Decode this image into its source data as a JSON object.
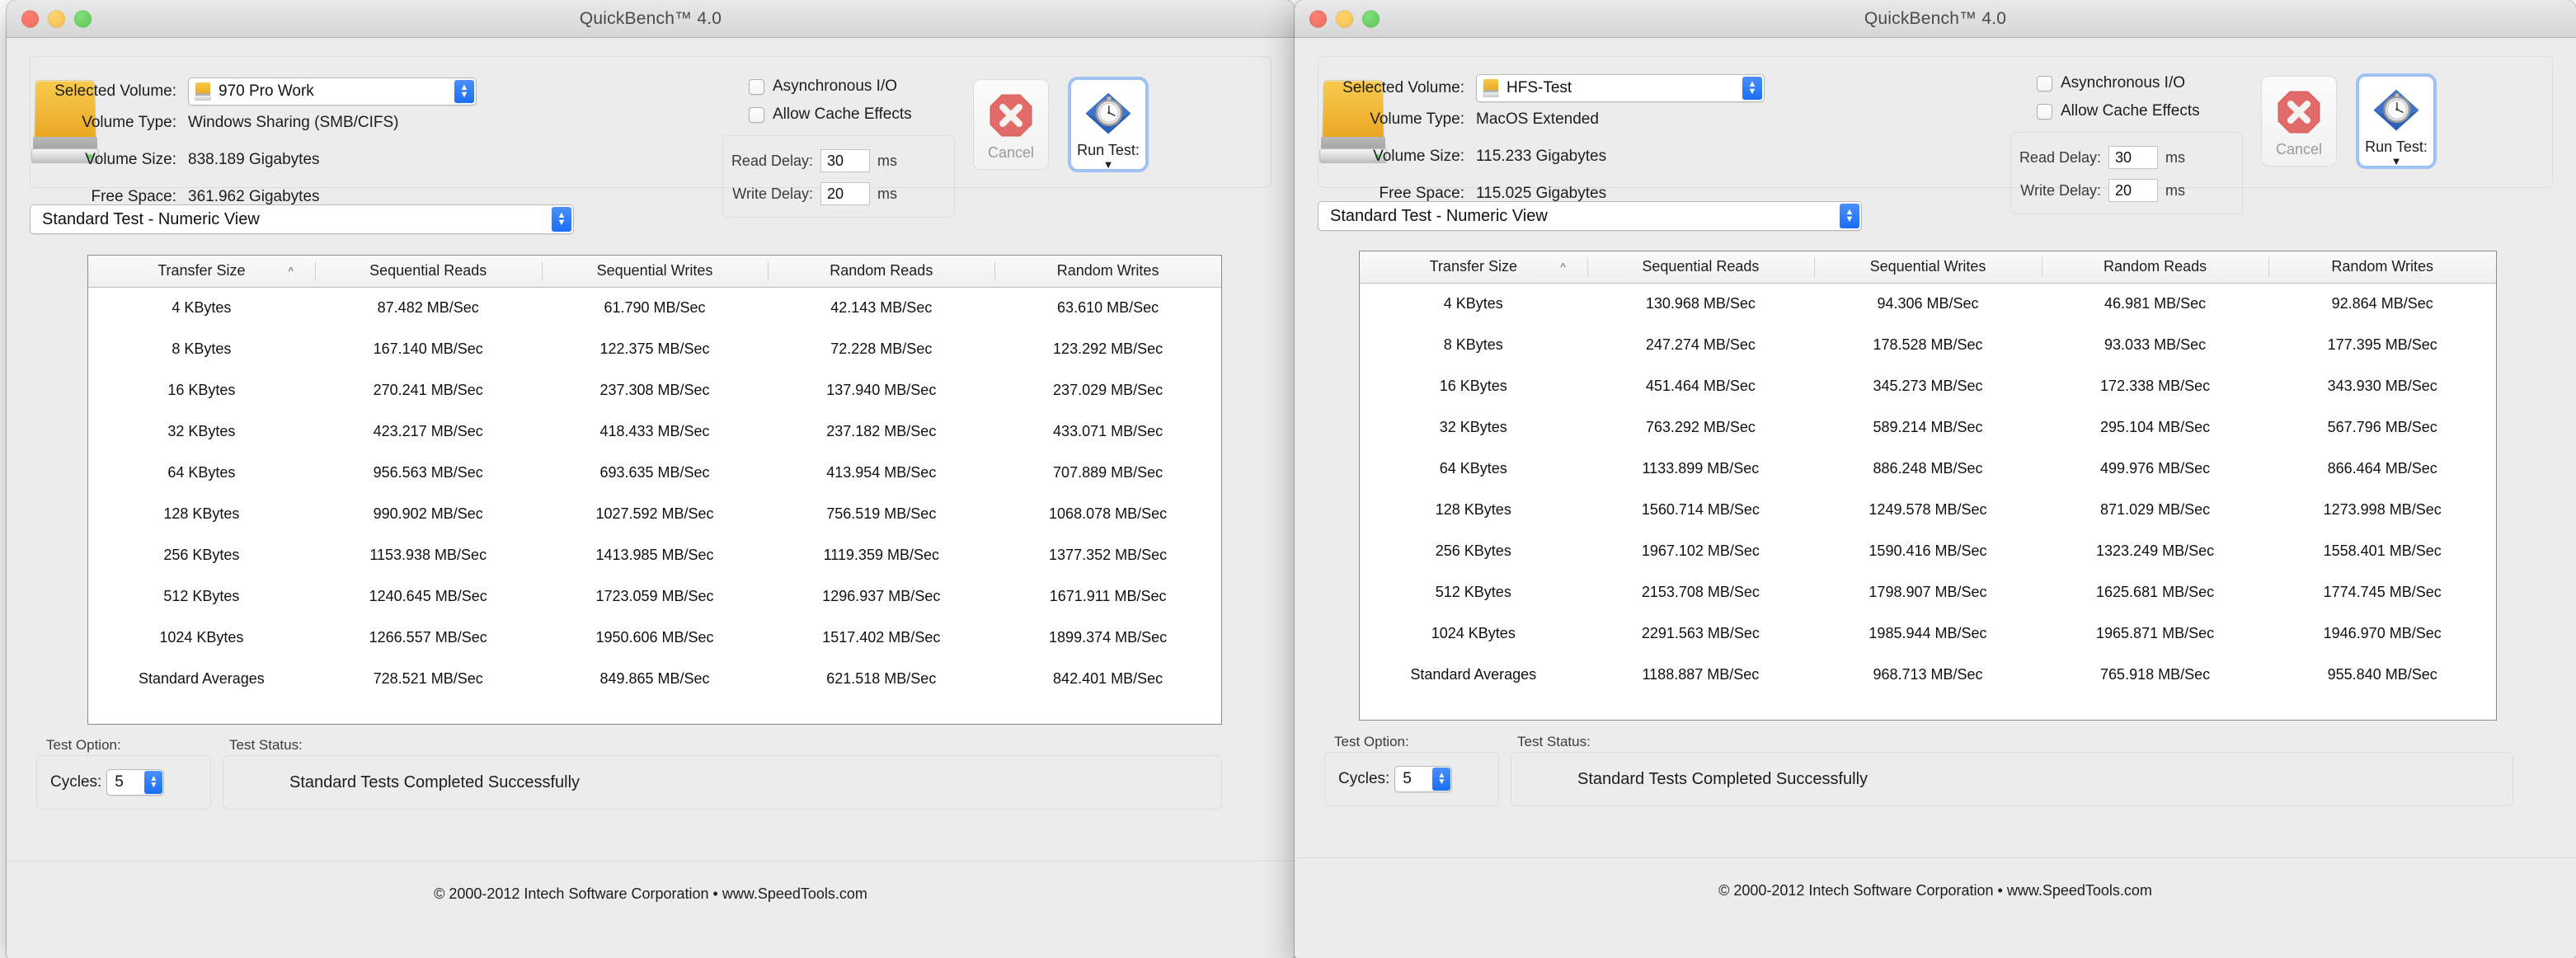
{
  "window_title": "QuickBench™ 4.0",
  "traffic_lights": [
    "close-button",
    "minimize-button",
    "zoom-button"
  ],
  "labels": {
    "selected_volume": "Selected Volume:",
    "volume_type": "Volume Type:",
    "volume_size": "Volume Size:",
    "free_space": "Free Space:",
    "async_io": "Asynchronous I/O",
    "allow_cache": "Allow Cache Effects",
    "read_delay": "Read Delay:",
    "write_delay": "Write Delay:",
    "ms": "ms",
    "cancel": "Cancel",
    "run_test": "Run Test:",
    "test_option": "Test Option:",
    "test_status": "Test Status:",
    "cycles": "Cycles:"
  },
  "columns": [
    "Transfer Size",
    "Sequential Reads",
    "Sequential Writes",
    "Random Reads",
    "Random Writes"
  ],
  "footer": "© 2000-2012 Intech Software Corporation • www.SpeedTools.com",
  "colors": {
    "accent_blue": "#1a6ef5",
    "focus_ring": "#64a0ff",
    "cancel_red": "#e06b68",
    "run_diamond": "#2b5fb8",
    "drive_yellow": "#f3bb3b",
    "window_bg": "#ececec",
    "led_green": "#6fd06f"
  },
  "left": {
    "volume_name": "970 Pro Work",
    "volume_type": "Windows Sharing (SMB/CIFS)",
    "volume_size": "838.189 Gigabytes",
    "free_space": "361.962 Gigabytes",
    "async_io_checked": false,
    "allow_cache_checked": false,
    "read_delay": "30",
    "write_delay": "20",
    "view_mode": "Standard Test - Numeric View",
    "cycles": "5",
    "status": "Standard Tests Completed Successfully",
    "rows": [
      [
        "4 KBytes",
        "87.482 MB/Sec",
        "61.790 MB/Sec",
        "42.143 MB/Sec",
        "63.610 MB/Sec"
      ],
      [
        "8 KBytes",
        "167.140 MB/Sec",
        "122.375 MB/Sec",
        "72.228 MB/Sec",
        "123.292 MB/Sec"
      ],
      [
        "16 KBytes",
        "270.241 MB/Sec",
        "237.308 MB/Sec",
        "137.940 MB/Sec",
        "237.029 MB/Sec"
      ],
      [
        "32 KBytes",
        "423.217 MB/Sec",
        "418.433 MB/Sec",
        "237.182 MB/Sec",
        "433.071 MB/Sec"
      ],
      [
        "64 KBytes",
        "956.563 MB/Sec",
        "693.635 MB/Sec",
        "413.954 MB/Sec",
        "707.889 MB/Sec"
      ],
      [
        "128 KBytes",
        "990.902 MB/Sec",
        "1027.592 MB/Sec",
        "756.519 MB/Sec",
        "1068.078 MB/Sec"
      ],
      [
        "256 KBytes",
        "1153.938 MB/Sec",
        "1413.985 MB/Sec",
        "1119.359 MB/Sec",
        "1377.352 MB/Sec"
      ],
      [
        "512 KBytes",
        "1240.645 MB/Sec",
        "1723.059 MB/Sec",
        "1296.937 MB/Sec",
        "1671.911 MB/Sec"
      ],
      [
        "1024 KBytes",
        "1266.557 MB/Sec",
        "1950.606 MB/Sec",
        "1517.402 MB/Sec",
        "1899.374 MB/Sec"
      ],
      [
        "Standard Averages",
        "728.521 MB/Sec",
        "849.865 MB/Sec",
        "621.518 MB/Sec",
        "842.401 MB/Sec"
      ]
    ]
  },
  "right": {
    "volume_name": "HFS-Test",
    "volume_type": "MacOS Extended",
    "volume_size": "115.233 Gigabytes",
    "free_space": "115.025 Gigabytes",
    "async_io_checked": false,
    "allow_cache_checked": false,
    "read_delay": "30",
    "write_delay": "20",
    "view_mode": "Standard Test - Numeric View",
    "cycles": "5",
    "status": "Standard Tests Completed Successfully",
    "rows": [
      [
        "4 KBytes",
        "130.968 MB/Sec",
        "94.306 MB/Sec",
        "46.981 MB/Sec",
        "92.864 MB/Sec"
      ],
      [
        "8 KBytes",
        "247.274 MB/Sec",
        "178.528 MB/Sec",
        "93.033 MB/Sec",
        "177.395 MB/Sec"
      ],
      [
        "16 KBytes",
        "451.464 MB/Sec",
        "345.273 MB/Sec",
        "172.338 MB/Sec",
        "343.930 MB/Sec"
      ],
      [
        "32 KBytes",
        "763.292 MB/Sec",
        "589.214 MB/Sec",
        "295.104 MB/Sec",
        "567.796 MB/Sec"
      ],
      [
        "64 KBytes",
        "1133.899 MB/Sec",
        "886.248 MB/Sec",
        "499.976 MB/Sec",
        "866.464 MB/Sec"
      ],
      [
        "128 KBytes",
        "1560.714 MB/Sec",
        "1249.578 MB/Sec",
        "871.029 MB/Sec",
        "1273.998 MB/Sec"
      ],
      [
        "256 KBytes",
        "1967.102 MB/Sec",
        "1590.416 MB/Sec",
        "1323.249 MB/Sec",
        "1558.401 MB/Sec"
      ],
      [
        "512 KBytes",
        "2153.708 MB/Sec",
        "1798.907 MB/Sec",
        "1625.681 MB/Sec",
        "1774.745 MB/Sec"
      ],
      [
        "1024 KBytes",
        "2291.563 MB/Sec",
        "1985.944 MB/Sec",
        "1965.871 MB/Sec",
        "1946.970 MB/Sec"
      ],
      [
        "Standard Averages",
        "1188.887 MB/Sec",
        "968.713 MB/Sec",
        "765.918 MB/Sec",
        "955.840 MB/Sec"
      ]
    ]
  }
}
